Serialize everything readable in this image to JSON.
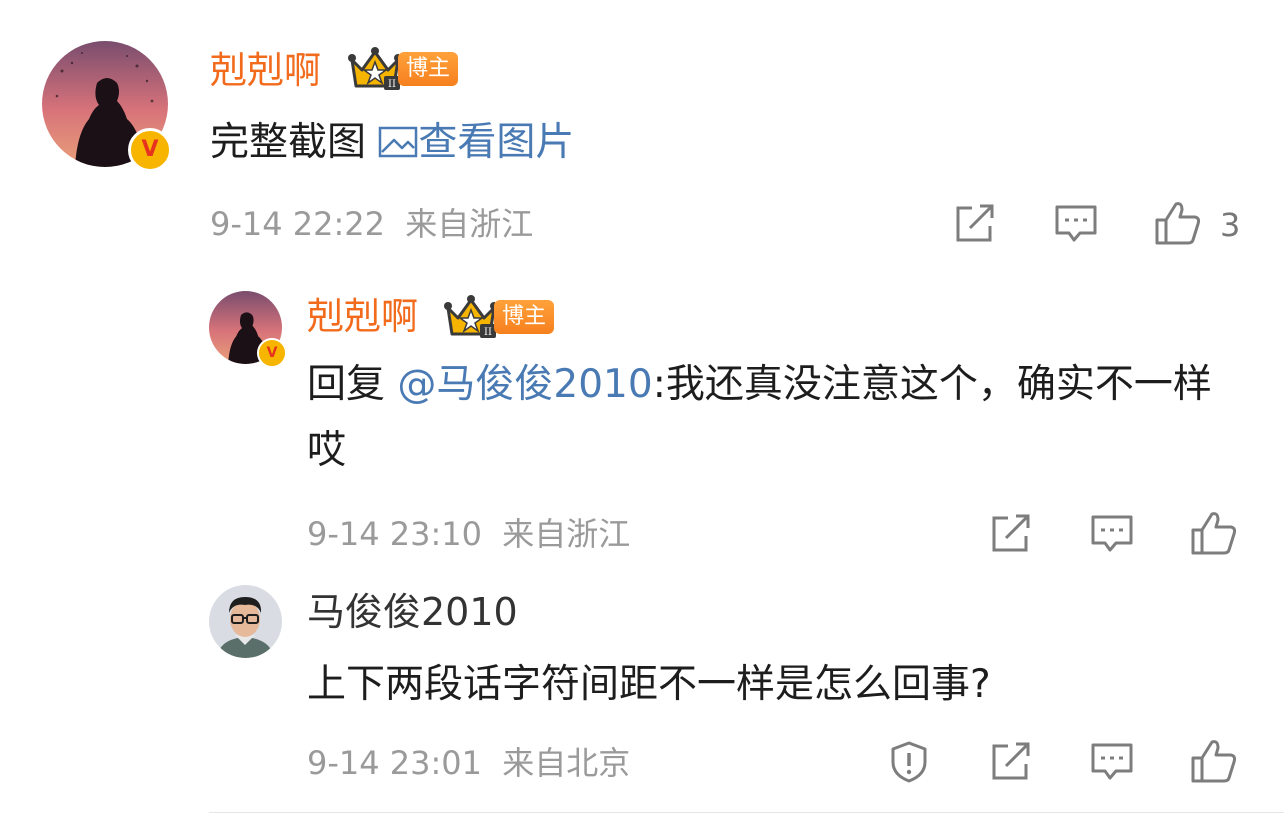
{
  "colors": {
    "username": "#f26b1d",
    "link": "#4a7ab3",
    "meta": "#9a9a9a",
    "icon": "#7d7d7d",
    "verified_bg": "#f7b500",
    "verified_mark": "#e6321e"
  },
  "comment": {
    "username": "剋剋啊",
    "role_badge": "博主",
    "crown_level": "II",
    "verified_mark": "V",
    "text": "完整截图",
    "image_link": "查看图片",
    "image_icon": "image-icon",
    "timestamp": "9-14 22:22",
    "location": "来自浙江",
    "like_count": "3"
  },
  "replies": [
    {
      "username": "剋剋啊",
      "role_badge": "博主",
      "crown_level": "II",
      "verified_mark": "V",
      "reply_prefix": "回复",
      "mention": "@马俊俊2010",
      "text": ":我还真没注意这个，确实不一样哎",
      "timestamp": "9-14 23:10",
      "location": "来自浙江"
    },
    {
      "username": "马俊俊2010",
      "text": "上下两段话字符间距不一样是怎么回事?",
      "timestamp": "9-14 23:01",
      "location": "来自北京"
    }
  ]
}
